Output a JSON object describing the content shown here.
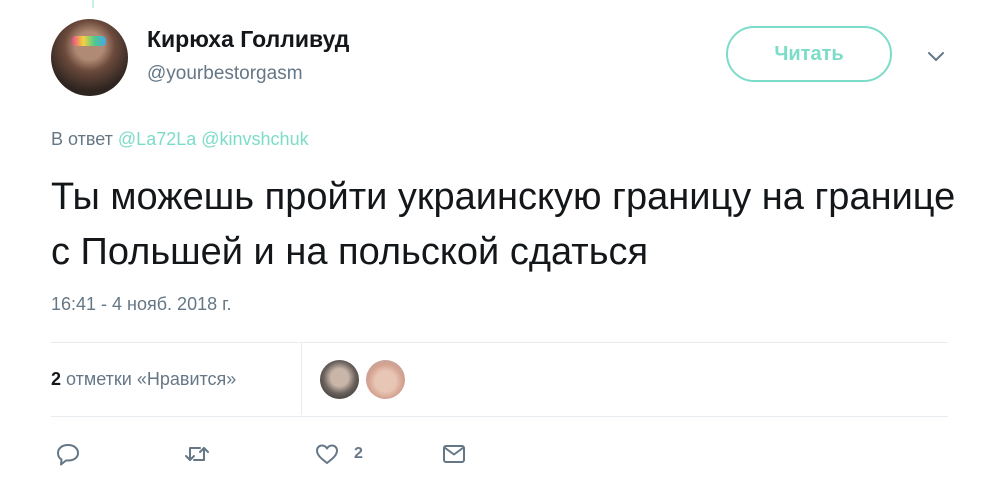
{
  "tweet": {
    "author": {
      "display_name": "Кирюха Голливуд",
      "handle": "@yourbestorgasm"
    },
    "follow_label": "Читать",
    "reply_prefix": "В ответ",
    "reply_to": [
      "@La72La",
      "@kinvshchuk"
    ],
    "text": "Ты можешь пройти украинскую границу на границе с Польшей и на польской сдаться",
    "timestamp": "16:41 - 4 нояб. 2018 г.",
    "likes": {
      "count": "2",
      "label": "отметки «Нравится»"
    },
    "actions": {
      "reply_icon": "reply-icon",
      "retweet_icon": "retweet-icon",
      "like_icon": "heart-icon",
      "like_count": "2",
      "dm_icon": "envelope-icon"
    }
  },
  "colors": {
    "accent": "#7ddcc8",
    "secondary_text": "#657786",
    "primary_text": "#14171a",
    "divider": "#e6ecf0"
  }
}
